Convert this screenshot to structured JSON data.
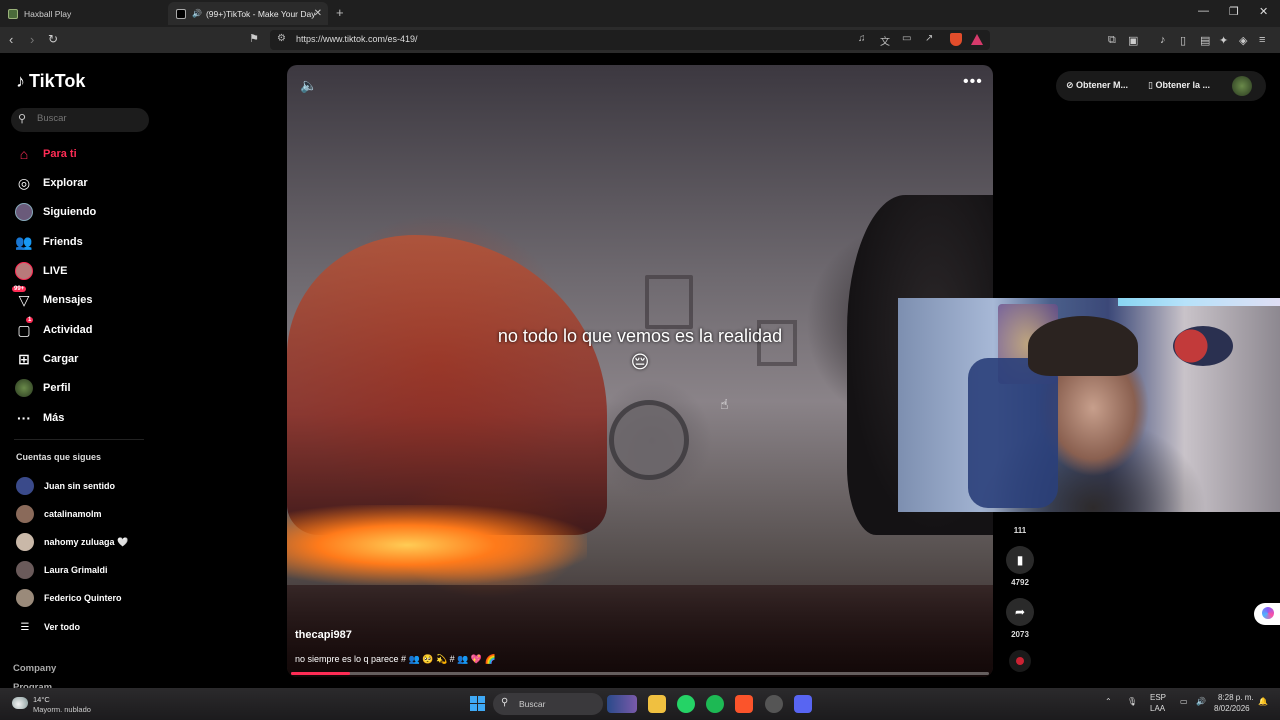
{
  "browser": {
    "tabs": [
      {
        "title": "Haxball Play",
        "active": false
      },
      {
        "title": "(99+)TikTok - Make Your Day",
        "active": true
      }
    ],
    "url": "https://www.tiktok.com/es-419/"
  },
  "sidebar": {
    "logo": "TikTok",
    "search_placeholder": "Buscar",
    "nav": [
      {
        "label": "Para ti",
        "icon": "home-icon",
        "active": true
      },
      {
        "label": "Explorar",
        "icon": "compass-icon"
      },
      {
        "label": "Siguiendo",
        "icon": "following-avatar-icon"
      },
      {
        "label": "Friends",
        "icon": "friends-icon"
      },
      {
        "label": "LIVE",
        "icon": "live-avatar-icon"
      },
      {
        "label": "Mensajes",
        "icon": "inbox-icon",
        "badge": "99+"
      },
      {
        "label": "Actividad",
        "icon": "activity-icon",
        "badge": "1"
      },
      {
        "label": "Cargar",
        "icon": "upload-icon"
      },
      {
        "label": "Perfil",
        "icon": "profile-avatar-icon"
      },
      {
        "label": "Más",
        "icon": "more-dots-icon"
      }
    ],
    "following_title": "Cuentas que sigues",
    "following": [
      {
        "name": "Juan sin sentido",
        "color": "#3a4a8a"
      },
      {
        "name": "catalinamolm",
        "color": "#8a6a5a"
      },
      {
        "name": "nahomy zuluaga 🤍",
        "color": "#c9b8a8"
      },
      {
        "name": "Laura Grimaldi",
        "color": "#6a5a5a"
      },
      {
        "name": "Federico Quintero",
        "color": "#9a8a7a"
      }
    ],
    "see_all": "Ver todo",
    "footer": [
      "Company",
      "Program"
    ]
  },
  "video": {
    "caption": "no todo lo que vemos es la realidad 😔",
    "author": "thecapi987",
    "description": "no siempre es lo q parece # 👥 🥺 💫 # 👥 💖 🌈",
    "progress": 0.085
  },
  "actions": [
    {
      "name": "comment",
      "icon": "comment-icon",
      "count": "111"
    },
    {
      "name": "bookmark",
      "icon": "bookmark-icon",
      "count": "4792"
    },
    {
      "name": "share",
      "icon": "share-icon",
      "count": "2073"
    }
  ],
  "topright": {
    "get_app1": "Obtener M...",
    "get_app2": "Obtener la ..."
  },
  "taskbar": {
    "temperature": "14°C",
    "weather": "Mayorm. nublado",
    "search": "Buscar",
    "lang1": "ESP",
    "lang2": "LAA",
    "time": "8:28 p. m.",
    "date": "8/02/2026"
  }
}
